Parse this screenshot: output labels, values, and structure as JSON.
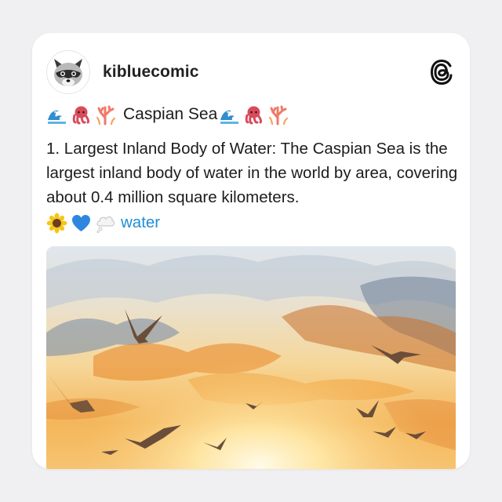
{
  "post": {
    "username": "kibluecomic",
    "title": "Caspian Sea",
    "title_emojis_before": [
      "wave-emoji",
      "octopus-emoji",
      "coral-emoji"
    ],
    "title_emojis_after": [
      "wave-emoji",
      "octopus-emoji",
      "coral-emoji"
    ],
    "body": "1. Largest Inland Body of Water: The Caspian Sea is the largest inland body of water in the world by area, covering about 0.4 million square kilometers.",
    "tag_emojis": [
      "sunflower-emoji",
      "blue-heart-emoji",
      "thought-bubble-emoji"
    ],
    "hashtag": "water",
    "image_icon": "watercolor-sunset-seagulls-image",
    "platform_icon": "threads-logo-icon"
  },
  "colors": {
    "hashtag": "#1d8fd6",
    "text": "#1c1c1c",
    "card": "#ffffff",
    "background": "#f0f0f2"
  }
}
